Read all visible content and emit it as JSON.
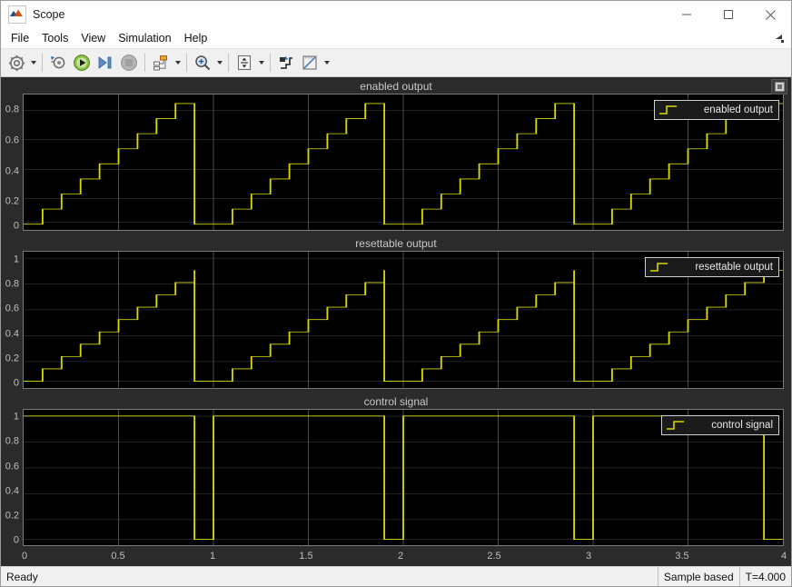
{
  "window": {
    "title": "Scope",
    "app_icon": "matlab-scope-icon",
    "controls": {
      "minimize": "minimize-icon",
      "maximize": "maximize-icon",
      "close": "close-icon"
    }
  },
  "menubar": {
    "items": [
      "File",
      "Tools",
      "View",
      "Simulation",
      "Help"
    ],
    "expander_icon": "menu-overflow-icon"
  },
  "toolbar": {
    "groups": [
      [
        {
          "name": "configuration-properties-button",
          "icon": "gear-icon",
          "has_arrow": true
        }
      ],
      [
        {
          "name": "simulation-parameters-button",
          "icon": "sim-params-icon",
          "has_arrow": false
        },
        {
          "name": "run-button",
          "icon": "play-icon",
          "has_arrow": false
        },
        {
          "name": "step-forward-button",
          "icon": "step-forward-icon",
          "has_arrow": false
        },
        {
          "name": "stop-button",
          "icon": "stop-icon",
          "has_arrow": false
        }
      ],
      [
        {
          "name": "signal-selection-button",
          "icon": "signal-selector-icon",
          "has_arrow": true
        }
      ],
      [
        {
          "name": "zoom-button",
          "icon": "zoom-magnifier-icon",
          "has_arrow": true
        }
      ],
      [
        {
          "name": "autoscale-button",
          "icon": "autoscale-icon",
          "has_arrow": true
        }
      ],
      [
        {
          "name": "style-button",
          "icon": "style-icon",
          "has_arrow": false
        },
        {
          "name": "measurements-button",
          "icon": "measurements-ruler-icon",
          "has_arrow": true
        }
      ]
    ]
  },
  "scope": {
    "float_button_icon": "undock-icon",
    "background": "#2b2b2b",
    "plot_background": "#000000",
    "trace_color": "#d9d900",
    "grid_color": "#5a5a5a",
    "text_color": "#bfbfbf",
    "xaxis": {
      "ticks": [
        "0",
        "0.5",
        "1",
        "1.5",
        "2",
        "2.5",
        "3",
        "3.5",
        "4"
      ],
      "min": 0,
      "max": 4
    }
  },
  "chart_data": [
    {
      "type": "line",
      "title": "enabled output",
      "legend": "enabled output",
      "legend_position": "top-right",
      "xlabel": "",
      "ylabel": "",
      "xlim": [
        0,
        4
      ],
      "ylim": [
        -0.04,
        0.86
      ],
      "yticks": [
        "0",
        "0.2",
        "0.4",
        "0.6",
        "0.8"
      ],
      "ytick_values": [
        0,
        0.2,
        0.4,
        0.6,
        0.8
      ],
      "xticks": [
        "0",
        "0.5",
        "1",
        "1.5",
        "2",
        "2.5",
        "3",
        "3.5",
        "4"
      ],
      "grid": true,
      "drawstyle": "steps-post",
      "series": [
        {
          "name": "enabled output",
          "color": "#d9d900",
          "x": [
            0,
            0.1,
            0.2,
            0.3,
            0.4,
            0.5,
            0.6,
            0.7,
            0.8,
            0.9,
            0.9,
            1.0,
            1.1,
            1.2,
            1.3,
            1.4,
            1.5,
            1.6,
            1.7,
            1.8,
            1.9,
            1.9,
            2.0,
            2.1,
            2.2,
            2.3,
            2.4,
            2.5,
            2.6,
            2.7,
            2.8,
            2.9,
            2.9,
            3.0,
            3.1,
            3.2,
            3.3,
            3.4,
            3.5,
            3.6,
            3.7,
            3.8,
            3.9,
            4.0
          ],
          "y": [
            0,
            0.1,
            0.2,
            0.3,
            0.4,
            0.5,
            0.6,
            0.7,
            0.8,
            0.8,
            0.0,
            0.0,
            0.1,
            0.2,
            0.3,
            0.4,
            0.5,
            0.6,
            0.7,
            0.8,
            0.8,
            0.0,
            0.0,
            0.1,
            0.2,
            0.3,
            0.4,
            0.5,
            0.6,
            0.7,
            0.8,
            0.8,
            0.0,
            0.0,
            0.1,
            0.2,
            0.3,
            0.4,
            0.5,
            0.6,
            0.7,
            0.8,
            0.8,
            0.8
          ]
        }
      ],
      "description": "Staircase ramp 0 to 0.8 in 0.1 steps, resets to 0 near t=0.9+n"
    },
    {
      "type": "line",
      "title": "resettable output",
      "legend": "resettable output",
      "legend_position": "top-right",
      "xlabel": "",
      "ylabel": "",
      "xlim": [
        0,
        4
      ],
      "ylim": [
        -0.05,
        1.05
      ],
      "yticks": [
        "0",
        "0.2",
        "0.4",
        "0.6",
        "0.8",
        "1"
      ],
      "ytick_values": [
        0,
        0.2,
        0.4,
        0.6,
        0.8,
        1.0
      ],
      "xticks": [
        "0",
        "0.5",
        "1",
        "1.5",
        "2",
        "2.5",
        "3",
        "3.5",
        "4"
      ],
      "grid": true,
      "drawstyle": "steps-post",
      "series": [
        {
          "name": "resettable output",
          "color": "#d9d900",
          "x": [
            0,
            0.1,
            0.2,
            0.3,
            0.4,
            0.5,
            0.6,
            0.7,
            0.8,
            0.9,
            0.9,
            1.0,
            1.1,
            1.2,
            1.3,
            1.4,
            1.5,
            1.6,
            1.7,
            1.8,
            1.9,
            1.9,
            2.0,
            2.1,
            2.2,
            2.3,
            2.4,
            2.5,
            2.6,
            2.7,
            2.8,
            2.9,
            2.9,
            3.0,
            3.1,
            3.2,
            3.3,
            3.4,
            3.5,
            3.6,
            3.7,
            3.8,
            3.9,
            4.0
          ],
          "y": [
            0,
            0.1,
            0.2,
            0.3,
            0.4,
            0.5,
            0.6,
            0.7,
            0.8,
            0.9,
            0.0,
            0.0,
            0.1,
            0.2,
            0.3,
            0.4,
            0.5,
            0.6,
            0.7,
            0.8,
            0.9,
            0.0,
            0.0,
            0.1,
            0.2,
            0.3,
            0.4,
            0.5,
            0.6,
            0.7,
            0.8,
            0.9,
            0.0,
            0.0,
            0.1,
            0.2,
            0.3,
            0.4,
            0.5,
            0.6,
            0.7,
            0.8,
            0.9,
            0.9
          ]
        }
      ],
      "description": "Staircase ramp 0 to 0.9 in 0.1 steps, resets to 0 at t=0.9+n"
    },
    {
      "type": "line",
      "title": "control signal",
      "legend": "control signal",
      "legend_position": "top-right",
      "xlabel": "",
      "ylabel": "",
      "xlim": [
        0,
        4
      ],
      "ylim": [
        -0.05,
        1.05
      ],
      "yticks": [
        "0",
        "0.2",
        "0.4",
        "0.6",
        "0.8",
        "1"
      ],
      "ytick_values": [
        0,
        0.2,
        0.4,
        0.6,
        0.8,
        1.0
      ],
      "xticks": [
        "0",
        "0.5",
        "1",
        "1.5",
        "2",
        "2.5",
        "3",
        "3.5",
        "4"
      ],
      "grid": true,
      "drawstyle": "steps-post",
      "series": [
        {
          "name": "control signal",
          "color": "#d9d900",
          "x": [
            0,
            0.9,
            1.0,
            1.9,
            2.0,
            2.9,
            3.0,
            3.9,
            4.0
          ],
          "y": [
            1,
            0,
            1,
            0,
            1,
            0,
            1,
            0,
            0
          ]
        }
      ],
      "description": "Constant 1 with one-sample drops to 0 at t=0.9, 1.9, 2.9, 3.9"
    }
  ],
  "statusbar": {
    "message": "Ready",
    "sample_mode": "Sample based",
    "time": "T=4.000"
  }
}
